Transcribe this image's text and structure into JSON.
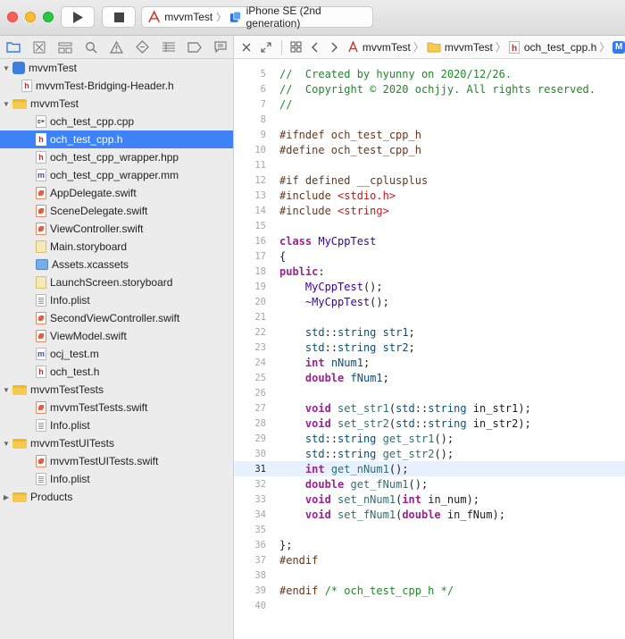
{
  "toolbar": {
    "scheme_project": "mvvmTest",
    "scheme_device": "iPhone SE (2nd generation)"
  },
  "navigator": {
    "items": [
      {
        "label": "mvvmTest",
        "icon": "project-icon",
        "indent": 0,
        "disclosure": "open"
      },
      {
        "label": "mvvmTest-Bridging-Header.h",
        "icon": "header-file-icon",
        "indent": 1
      },
      {
        "label": "mvvmTest",
        "icon": "folder-icon",
        "indent": 0,
        "disclosure": "open"
      },
      {
        "label": "och_test_cpp.cpp",
        "icon": "cpp-file-icon",
        "indent": 2
      },
      {
        "label": "och_test_cpp.h",
        "icon": "header-file-icon",
        "indent": 2,
        "selected": true
      },
      {
        "label": "och_test_cpp_wrapper.hpp",
        "icon": "header-file-icon",
        "indent": 2
      },
      {
        "label": "och_test_cpp_wrapper.mm",
        "icon": "objc-file-icon",
        "indent": 2
      },
      {
        "label": "AppDelegate.swift",
        "icon": "swift-file-icon",
        "indent": 2
      },
      {
        "label": "SceneDelegate.swift",
        "icon": "swift-file-icon",
        "indent": 2
      },
      {
        "label": "ViewController.swift",
        "icon": "swift-file-icon",
        "indent": 2
      },
      {
        "label": "Main.storyboard",
        "icon": "storyboard-file-icon",
        "indent": 2
      },
      {
        "label": "Assets.xcassets",
        "icon": "assets-icon",
        "indent": 2
      },
      {
        "label": "LaunchScreen.storyboard",
        "icon": "storyboard-file-icon",
        "indent": 2
      },
      {
        "label": "Info.plist",
        "icon": "plist-file-icon",
        "indent": 2
      },
      {
        "label": "SecondViewController.swift",
        "icon": "swift-file-icon",
        "indent": 2
      },
      {
        "label": "ViewModel.swift",
        "icon": "swift-file-icon",
        "indent": 2
      },
      {
        "label": "ocj_test.m",
        "icon": "objc-file-icon",
        "indent": 2
      },
      {
        "label": "och_test.h",
        "icon": "header-file-icon",
        "indent": 2
      },
      {
        "label": "mvvmTestTests",
        "icon": "folder-icon",
        "indent": 0,
        "disclosure": "open"
      },
      {
        "label": "mvvmTestTests.swift",
        "icon": "swift-file-icon",
        "indent": 2
      },
      {
        "label": "Info.plist",
        "icon": "plist-file-icon",
        "indent": 2
      },
      {
        "label": "mvvmTestUITests",
        "icon": "folder-icon",
        "indent": 0,
        "disclosure": "open"
      },
      {
        "label": "mvvmTestUITests.swift",
        "icon": "swift-file-icon",
        "indent": 2
      },
      {
        "label": "Info.plist",
        "icon": "plist-file-icon",
        "indent": 2
      },
      {
        "label": "Products",
        "icon": "folder-icon",
        "indent": 0,
        "disclosure": "closed"
      }
    ]
  },
  "jumpbar": {
    "crumbs": [
      "mvvmTest",
      "mvvmTest",
      "och_test_cpp.h"
    ],
    "trailing_badge": "M"
  },
  "editor": {
    "current_line": 31,
    "lines": [
      {
        "n": "5",
        "tokens": [
          [
            "c-com",
            "//  Created by hyunny on 2020/12/26."
          ]
        ]
      },
      {
        "n": "6",
        "tokens": [
          [
            "c-com",
            "//  Copyright © 2020 ochjjy. All rights reserved."
          ]
        ]
      },
      {
        "n": "7",
        "tokens": [
          [
            "c-com",
            "//"
          ]
        ]
      },
      {
        "n": "8",
        "tokens": []
      },
      {
        "n": "9",
        "tokens": [
          [
            "c-pp",
            "#ifndef och_test_cpp_h"
          ]
        ]
      },
      {
        "n": "10",
        "tokens": [
          [
            "c-pp",
            "#define och_test_cpp_h"
          ]
        ]
      },
      {
        "n": "11",
        "tokens": []
      },
      {
        "n": "12",
        "tokens": [
          [
            "c-pp",
            "#if defined __cplusplus"
          ]
        ]
      },
      {
        "n": "13",
        "tokens": [
          [
            "c-pp",
            "#include "
          ],
          [
            "c-str",
            "<stdio.h>"
          ]
        ]
      },
      {
        "n": "14",
        "tokens": [
          [
            "c-pp",
            "#include "
          ],
          [
            "c-str",
            "<string>"
          ]
        ]
      },
      {
        "n": "15",
        "tokens": []
      },
      {
        "n": "16",
        "tokens": [
          [
            "c-kw",
            "class"
          ],
          [
            "c-plain",
            " "
          ],
          [
            "c-cls",
            "MyCppTest"
          ]
        ]
      },
      {
        "n": "17",
        "tokens": [
          [
            "c-plain",
            "{"
          ]
        ]
      },
      {
        "n": "18",
        "tokens": [
          [
            "c-kw",
            "public"
          ],
          [
            "c-plain",
            ":"
          ]
        ]
      },
      {
        "n": "19",
        "tokens": [
          [
            "c-plain",
            "    "
          ],
          [
            "c-cls",
            "MyCppTest"
          ],
          [
            "c-plain",
            "();"
          ]
        ]
      },
      {
        "n": "20",
        "tokens": [
          [
            "c-plain",
            "    ~"
          ],
          [
            "c-cls",
            "MyCppTest"
          ],
          [
            "c-plain",
            "();"
          ]
        ]
      },
      {
        "n": "21",
        "tokens": []
      },
      {
        "n": "22",
        "tokens": [
          [
            "c-plain",
            "    "
          ],
          [
            "c-type",
            "std"
          ],
          [
            "c-plain",
            "::"
          ],
          [
            "c-type",
            "string"
          ],
          [
            "c-plain",
            " "
          ],
          [
            "c-type",
            "str1"
          ],
          [
            "c-plain",
            ";"
          ]
        ]
      },
      {
        "n": "23",
        "tokens": [
          [
            "c-plain",
            "    "
          ],
          [
            "c-type",
            "std"
          ],
          [
            "c-plain",
            "::"
          ],
          [
            "c-type",
            "string"
          ],
          [
            "c-plain",
            " "
          ],
          [
            "c-type",
            "str2"
          ],
          [
            "c-plain",
            ";"
          ]
        ]
      },
      {
        "n": "24",
        "tokens": [
          [
            "c-plain",
            "    "
          ],
          [
            "c-kw",
            "int"
          ],
          [
            "c-plain",
            " "
          ],
          [
            "c-type",
            "nNum1"
          ],
          [
            "c-plain",
            ";"
          ]
        ]
      },
      {
        "n": "25",
        "tokens": [
          [
            "c-plain",
            "    "
          ],
          [
            "c-kw",
            "double"
          ],
          [
            "c-plain",
            " "
          ],
          [
            "c-type",
            "fNum1"
          ],
          [
            "c-plain",
            ";"
          ]
        ]
      },
      {
        "n": "26",
        "tokens": []
      },
      {
        "n": "27",
        "tokens": [
          [
            "c-plain",
            "    "
          ],
          [
            "c-kw",
            "void"
          ],
          [
            "c-plain",
            " "
          ],
          [
            "c-fn",
            "set_str1"
          ],
          [
            "c-plain",
            "("
          ],
          [
            "c-type",
            "std"
          ],
          [
            "c-plain",
            "::"
          ],
          [
            "c-type",
            "string"
          ],
          [
            "c-plain",
            " in_str1);"
          ]
        ]
      },
      {
        "n": "28",
        "tokens": [
          [
            "c-plain",
            "    "
          ],
          [
            "c-kw",
            "void"
          ],
          [
            "c-plain",
            " "
          ],
          [
            "c-fn",
            "set_str2"
          ],
          [
            "c-plain",
            "("
          ],
          [
            "c-type",
            "std"
          ],
          [
            "c-plain",
            "::"
          ],
          [
            "c-type",
            "string"
          ],
          [
            "c-plain",
            " in_str2);"
          ]
        ]
      },
      {
        "n": "29",
        "tokens": [
          [
            "c-plain",
            "    "
          ],
          [
            "c-type",
            "std"
          ],
          [
            "c-plain",
            "::"
          ],
          [
            "c-type",
            "string"
          ],
          [
            "c-plain",
            " "
          ],
          [
            "c-fn",
            "get_str1"
          ],
          [
            "c-plain",
            "();"
          ]
        ]
      },
      {
        "n": "30",
        "tokens": [
          [
            "c-plain",
            "    "
          ],
          [
            "c-type",
            "std"
          ],
          [
            "c-plain",
            "::"
          ],
          [
            "c-type",
            "string"
          ],
          [
            "c-plain",
            " "
          ],
          [
            "c-fn",
            "get_str2"
          ],
          [
            "c-plain",
            "();"
          ]
        ]
      },
      {
        "n": "31",
        "tokens": [
          [
            "c-plain",
            "    "
          ],
          [
            "c-kw",
            "int"
          ],
          [
            "c-plain",
            " "
          ],
          [
            "c-fn",
            "get_nNum1"
          ],
          [
            "c-plain",
            "();"
          ]
        ]
      },
      {
        "n": "32",
        "tokens": [
          [
            "c-plain",
            "    "
          ],
          [
            "c-kw",
            "double"
          ],
          [
            "c-plain",
            " "
          ],
          [
            "c-fn",
            "get_fNum1"
          ],
          [
            "c-plain",
            "();"
          ]
        ]
      },
      {
        "n": "33",
        "tokens": [
          [
            "c-plain",
            "    "
          ],
          [
            "c-kw",
            "void"
          ],
          [
            "c-plain",
            " "
          ],
          [
            "c-fn",
            "set_nNum1"
          ],
          [
            "c-plain",
            "("
          ],
          [
            "c-kw",
            "int"
          ],
          [
            "c-plain",
            " in_num);"
          ]
        ]
      },
      {
        "n": "34",
        "tokens": [
          [
            "c-plain",
            "    "
          ],
          [
            "c-kw",
            "void"
          ],
          [
            "c-plain",
            " "
          ],
          [
            "c-fn",
            "set_fNum1"
          ],
          [
            "c-plain",
            "("
          ],
          [
            "c-kw",
            "double"
          ],
          [
            "c-plain",
            " in_fNum);"
          ]
        ]
      },
      {
        "n": "35",
        "tokens": []
      },
      {
        "n": "36",
        "tokens": [
          [
            "c-plain",
            "};"
          ]
        ]
      },
      {
        "n": "37",
        "tokens": [
          [
            "c-pp",
            "#endif"
          ]
        ]
      },
      {
        "n": "38",
        "tokens": []
      },
      {
        "n": "39",
        "tokens": [
          [
            "c-pp",
            "#endif "
          ],
          [
            "c-com",
            "/* och_test_cpp_h */"
          ]
        ]
      },
      {
        "n": "40",
        "tokens": []
      }
    ]
  },
  "colors": {
    "selection": "#3f82f7",
    "current_line": "#e8f2ff",
    "comment": "#23862a",
    "keyword": "#9b2393",
    "string": "#c41a16"
  }
}
